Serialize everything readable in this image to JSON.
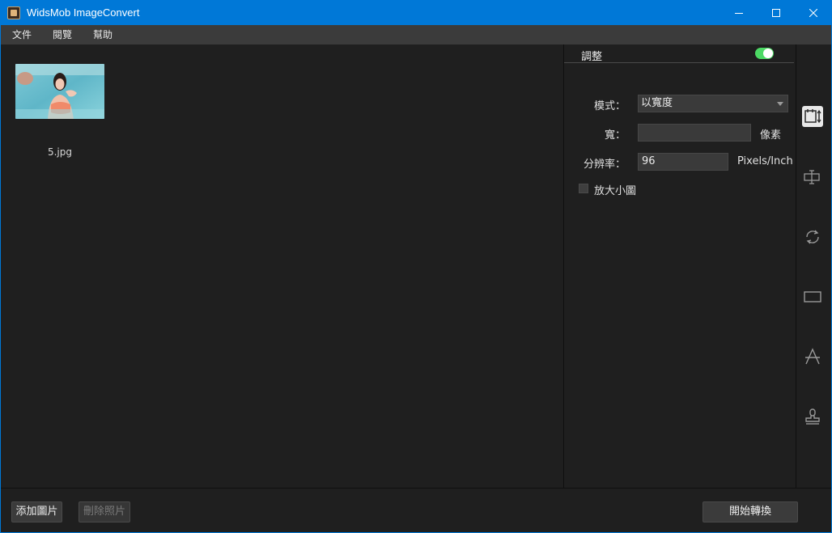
{
  "window": {
    "title": "WidsMob ImageConvert",
    "accent": "#0078d7"
  },
  "menu": {
    "items": [
      "文件",
      "閱覽",
      "幫助"
    ]
  },
  "gallery": {
    "items": [
      {
        "filename": "5.jpg"
      }
    ]
  },
  "panel": {
    "title": "調整",
    "toggle_on": true,
    "mode_label": "模式：",
    "mode_value": "以寬度",
    "width_label": "寬：",
    "width_value": "",
    "width_unit": "像素",
    "resolution_label": "分辨率：",
    "resolution_value": "96",
    "resolution_unit": "Pixels/Inch",
    "enlarge_label": "放大小圖",
    "enlarge_checked": false
  },
  "sidetools": [
    "resize-icon",
    "watermark-text-icon",
    "rotate-icon",
    "border-icon",
    "text-icon",
    "stamp-icon"
  ],
  "bottom": {
    "add_label": "添加圖片",
    "remove_label": "刪除照片",
    "convert_label": "開始轉換"
  }
}
